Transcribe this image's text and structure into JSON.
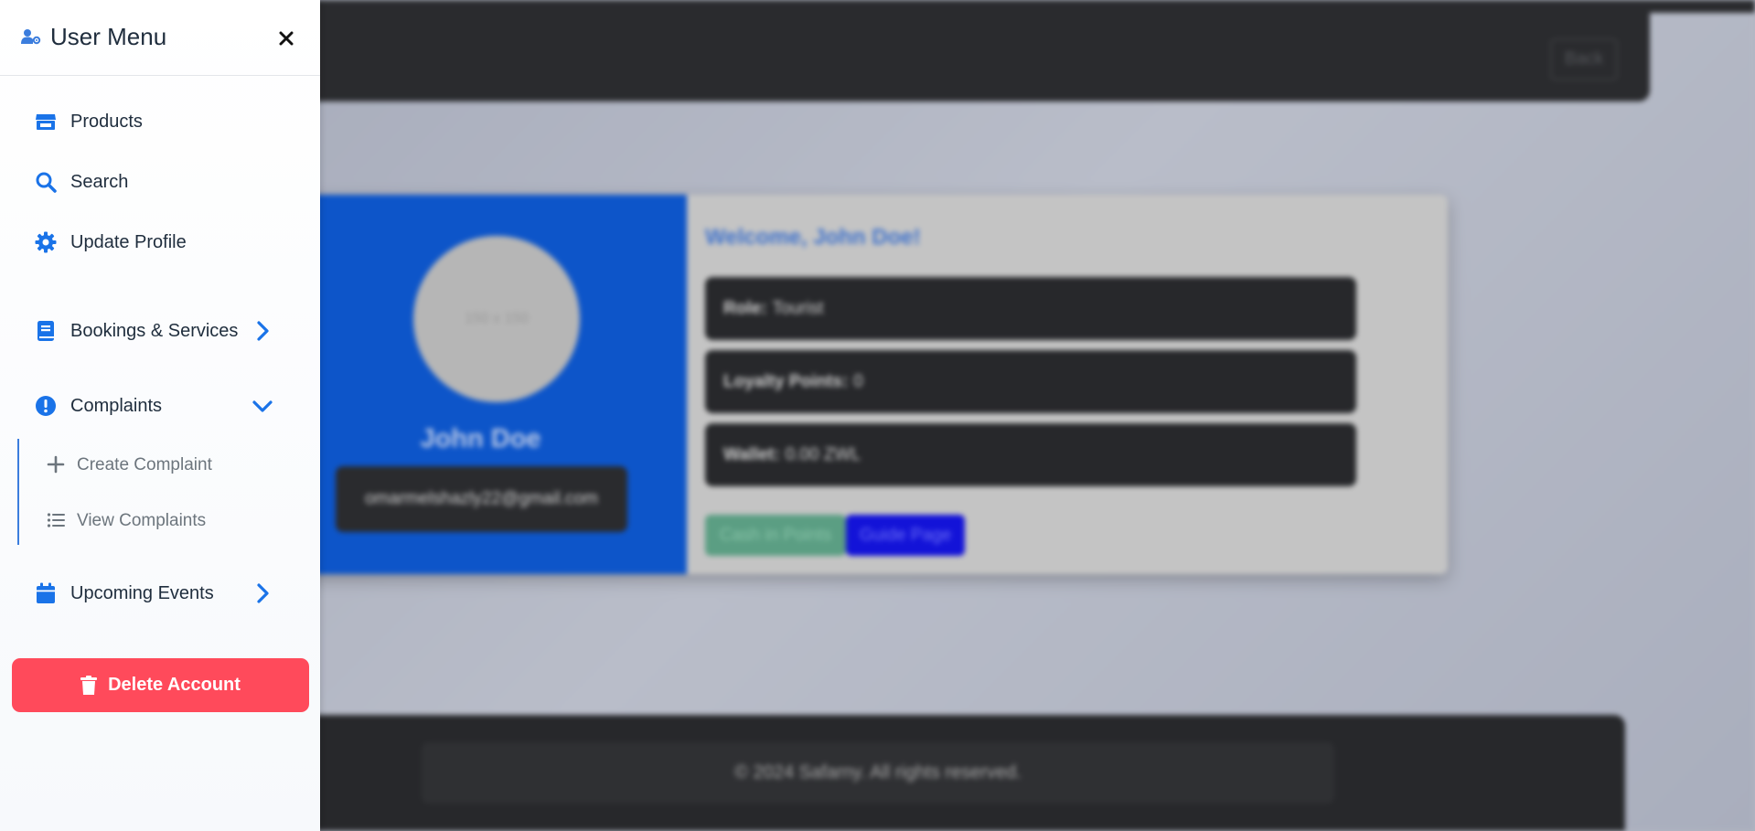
{
  "background": {
    "back_label": "Back",
    "avatar_placeholder": "150 x 150",
    "profile_name": "John Doe",
    "profile_email": "omarmelshazly22@gmail.com",
    "welcome": "Welcome, John Doe!",
    "info": [
      {
        "label": "Role:",
        "value": "Tourist"
      },
      {
        "label": "Loyalty Points:",
        "value": "0"
      },
      {
        "label": "Wallet:",
        "value": "0.00 ZWL"
      }
    ],
    "cash_button": "Cash in Points",
    "guide_button": "Guide Page",
    "footer": "© 2024 Safarny. All rights reserved."
  },
  "sidebar": {
    "title": "User Menu",
    "header_icon": "user-gear-icon",
    "close_icon": "close-icon",
    "items": [
      {
        "label": "Products",
        "icon": "store-icon"
      },
      {
        "label": "Search",
        "icon": "search-icon"
      },
      {
        "label": "Update Profile",
        "icon": "gear-icon"
      },
      {
        "label": "Bookings & Services",
        "icon": "book-icon",
        "chevron": "chevron-right-icon"
      },
      {
        "label": "Complaints",
        "icon": "exclamation-circle-icon",
        "chevron": "chevron-down-icon"
      },
      {
        "label": "Upcoming Events",
        "icon": "calendar-icon",
        "chevron": "chevron-right-icon"
      }
    ],
    "complaints_sub": [
      {
        "label": "Create Complaint",
        "icon": "plus-icon"
      },
      {
        "label": "View Complaints",
        "icon": "list-icon"
      }
    ],
    "delete_label": "Delete Account",
    "delete_icon": "trash-icon"
  },
  "colors": {
    "accent": "#1a73e8",
    "danger": "#ff4a5b",
    "text": "#1f2d3d",
    "muted": "#6c757d"
  }
}
